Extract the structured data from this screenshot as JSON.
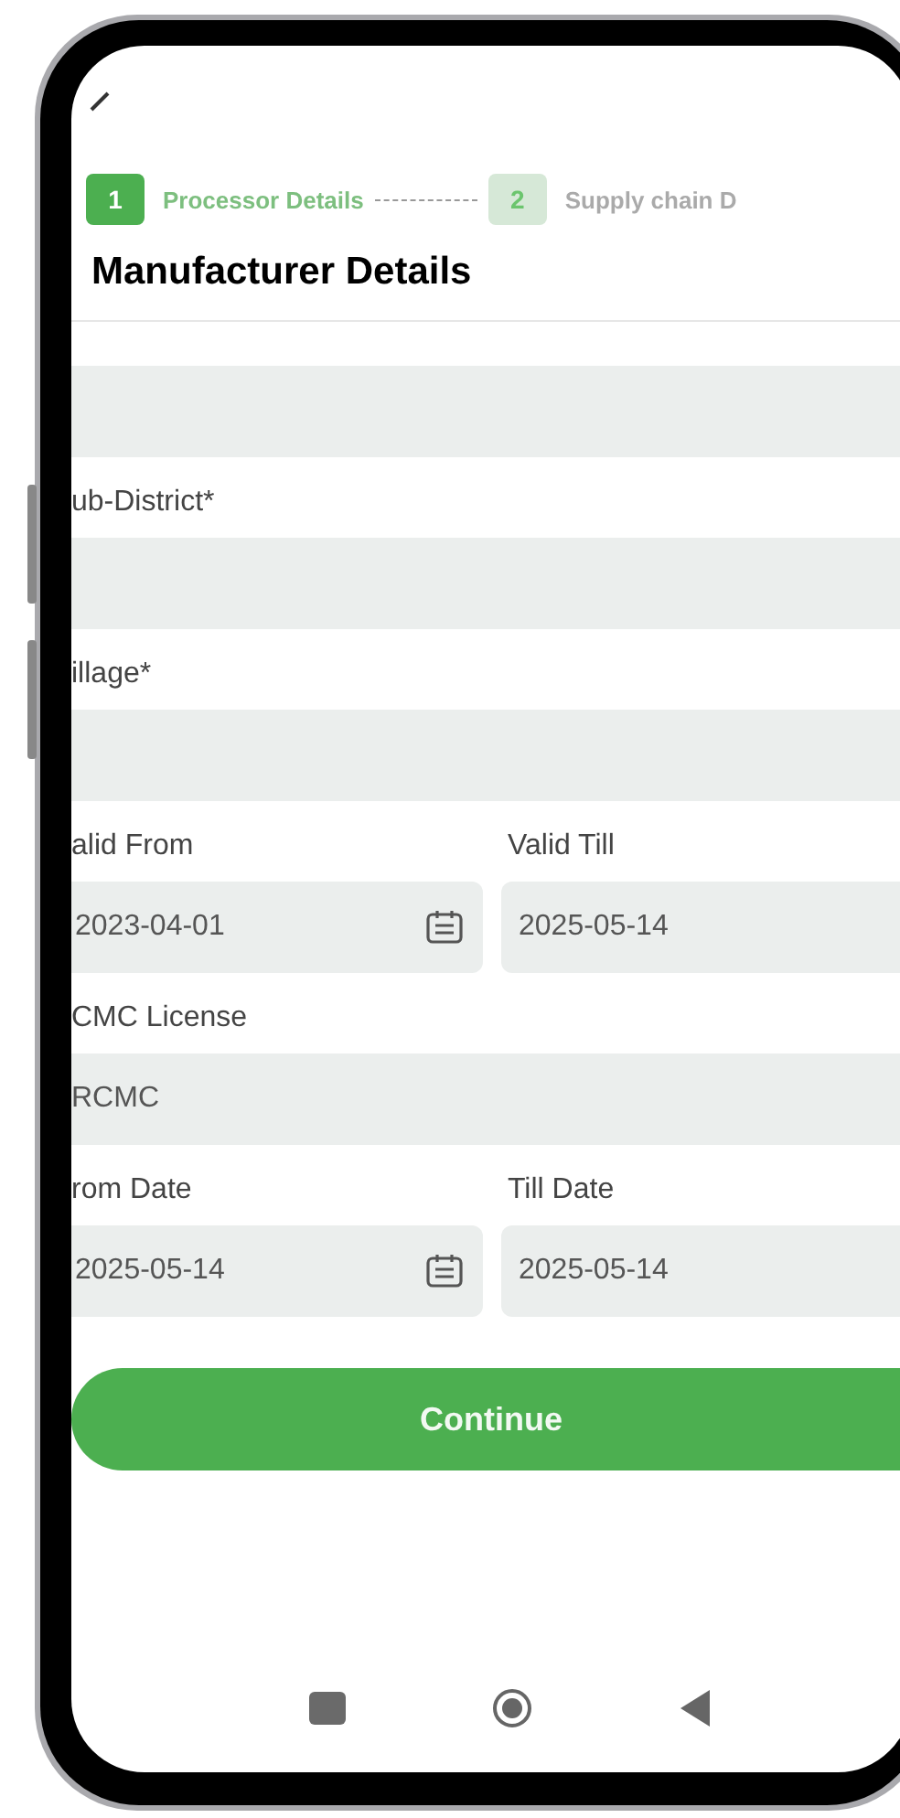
{
  "steps": [
    {
      "number": "1",
      "label": "Processor Details",
      "selected": true
    },
    {
      "number": "2",
      "label": "Supply chain D",
      "selected": false
    }
  ],
  "title": "Manufacturer Details",
  "form": [
    {
      "kind": "select"
    },
    {
      "kind": "select",
      "label": "ub-District*"
    },
    {
      "kind": "select",
      "label": "illage*"
    },
    {
      "kind": "dates",
      "items": [
        {
          "label": "alid From",
          "value": "2023-04-01"
        },
        {
          "label": "Valid Till",
          "value": "2025-05-14"
        }
      ]
    },
    {
      "kind": "text",
      "label": "CMC License",
      "value": "RCMC"
    },
    {
      "kind": "dates",
      "items": [
        {
          "label": "rom Date",
          "value": "2025-05-14"
        },
        {
          "label": "Till Date",
          "value": "2025-05-14"
        }
      ]
    }
  ],
  "continue_button": "Continue"
}
